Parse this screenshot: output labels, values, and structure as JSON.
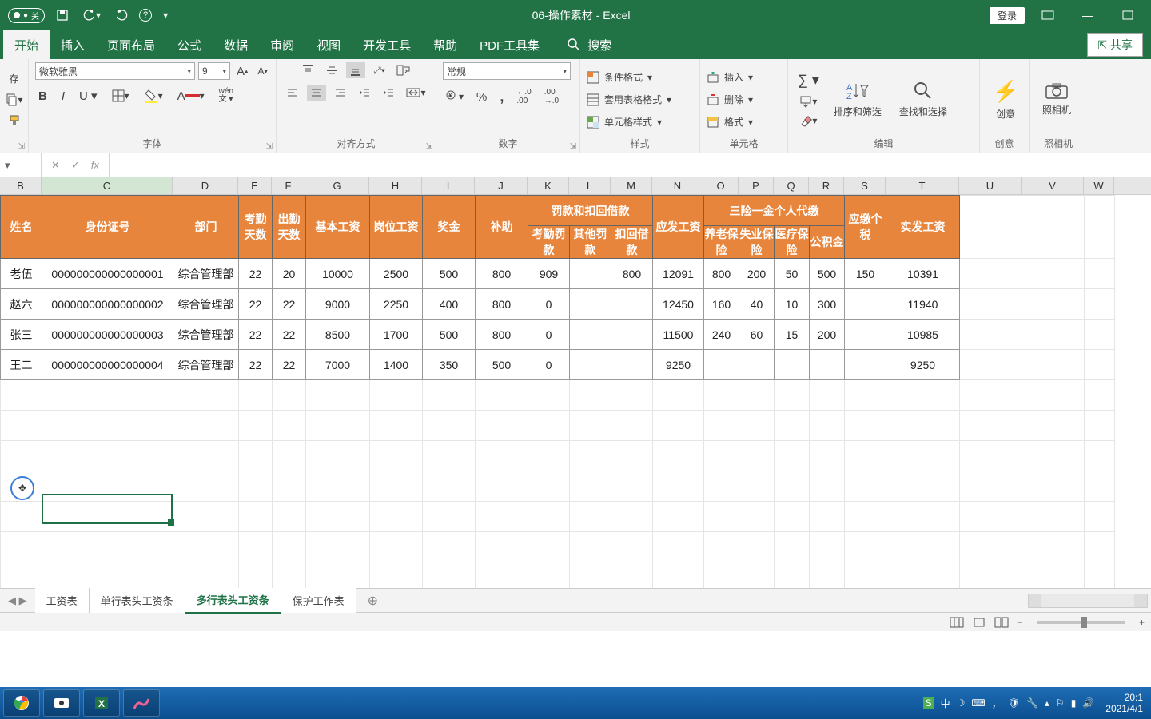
{
  "title": "06-操作素材 - Excel",
  "qat": {
    "autosave_off": "关",
    "autosave_dot": "●"
  },
  "login": "登录",
  "tabs": [
    "开始",
    "插入",
    "页面布局",
    "公式",
    "数据",
    "审阅",
    "视图",
    "开发工具",
    "帮助",
    "PDF工具集"
  ],
  "active_tab": 0,
  "search_label": "搜索",
  "share": "共享",
  "font": {
    "name": "微软雅黑",
    "size": "9",
    "group": "字体"
  },
  "align_group": "对齐方式",
  "number": {
    "format": "常规",
    "group": "数字"
  },
  "styles": {
    "cond": "条件格式",
    "table": "套用表格格式",
    "cell": "单元格样式",
    "group": "样式"
  },
  "cells": {
    "insert": "插入",
    "delete": "删除",
    "format": "格式",
    "group": "单元格"
  },
  "editing": {
    "sort": "排序和筛选",
    "find": "查找和选择",
    "group": "编辑"
  },
  "ideas": {
    "label": "创意",
    "group": "创意"
  },
  "camera": {
    "label": "照相机",
    "group": "照相机"
  },
  "cols": [
    "B",
    "C",
    "D",
    "E",
    "F",
    "G",
    "H",
    "I",
    "J",
    "K",
    "L",
    "M",
    "N",
    "O",
    "P",
    "Q",
    "R",
    "S",
    "T",
    "U",
    "V",
    "W"
  ],
  "selected_col": "C",
  "headers": {
    "name": "姓名",
    "id": "身份证号",
    "dept": "部门",
    "attend": "考勤天数",
    "work": "出勤天数",
    "base": "基本工资",
    "post": "岗位工资",
    "bonus": "奖金",
    "allow": "补助",
    "penalty_group": "罚款和扣回借款",
    "attend_fine": "考勤罚款",
    "other_fine": "其他罚款",
    "deduct": "扣回借款",
    "due": "应发工资",
    "ins_group": "三险一金个人代缴",
    "pension": "养老保险",
    "unemp": "失业保险",
    "medical": "医疗保险",
    "fund": "公积金",
    "tax": "应缴个税",
    "net": "实发工资"
  },
  "rows": [
    {
      "name": "老伍",
      "id": "000000000000000001",
      "dept": "综合管理部",
      "e": "22",
      "f": "20",
      "g": "10000",
      "h": "2500",
      "i": "500",
      "j": "800",
      "k": "909",
      "l": "",
      "m": "800",
      "n": "12091",
      "o": "800",
      "p": "200",
      "q": "50",
      "r": "500",
      "s": "150",
      "t": "10391"
    },
    {
      "name": "赵六",
      "id": "000000000000000002",
      "dept": "综合管理部",
      "e": "22",
      "f": "22",
      "g": "9000",
      "h": "2250",
      "i": "400",
      "j": "800",
      "k": "0",
      "l": "",
      "m": "",
      "n": "12450",
      "o": "160",
      "p": "40",
      "q": "10",
      "r": "300",
      "s": "",
      "t": "11940"
    },
    {
      "name": "张三",
      "id": "000000000000000003",
      "dept": "综合管理部",
      "e": "22",
      "f": "22",
      "g": "8500",
      "h": "1700",
      "i": "500",
      "j": "800",
      "k": "0",
      "l": "",
      "m": "",
      "n": "11500",
      "o": "240",
      "p": "60",
      "q": "15",
      "r": "200",
      "s": "",
      "t": "10985"
    },
    {
      "name": "王二",
      "id": "000000000000000004",
      "dept": "综合管理部",
      "e": "22",
      "f": "22",
      "g": "7000",
      "h": "1400",
      "i": "350",
      "j": "500",
      "k": "0",
      "l": "",
      "m": "",
      "n": "9250",
      "o": "",
      "p": "",
      "q": "",
      "r": "",
      "s": "",
      "t": "9250"
    }
  ],
  "sheets": [
    "工资表",
    "单行表头工资条",
    "多行表头工资条",
    "保护工作表"
  ],
  "active_sheet": 2,
  "tray": {
    "ime": "中",
    "time": "20:1",
    "date": "2021/4/1"
  }
}
